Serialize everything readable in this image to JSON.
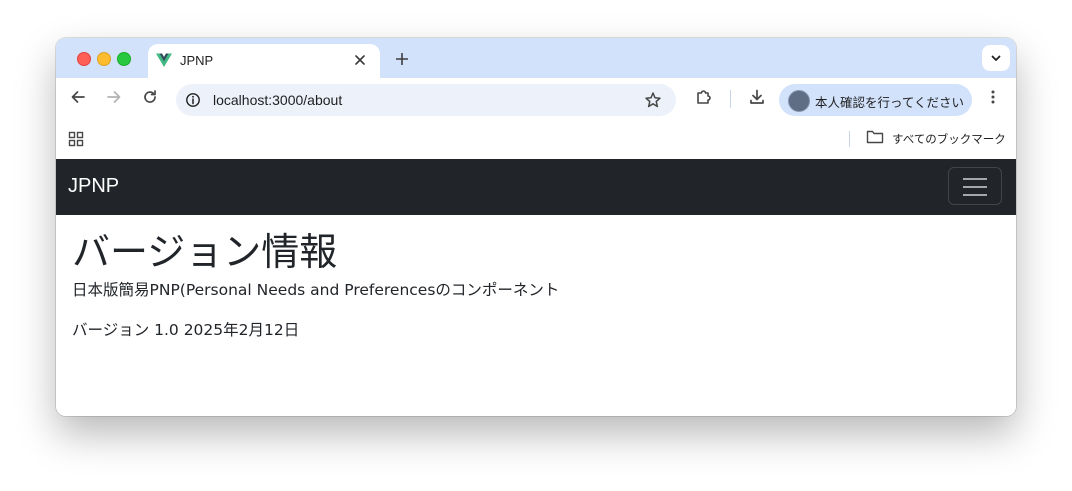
{
  "browser": {
    "tab": {
      "title": "JPNP"
    },
    "address_bar": {
      "url": "localhost:3000/about"
    },
    "profile": {
      "label": "本人確認を行ってください"
    },
    "bookmarks": {
      "all_bookmarks_label": "すべてのブックマーク"
    },
    "icons": {
      "back": "arrow-left-icon",
      "forward": "arrow-right-icon",
      "reload": "reload-icon",
      "info": "info-icon",
      "bookmark_star": "star-icon",
      "extensions": "puzzle-icon",
      "download": "download-icon",
      "menu": "more-vert-icon",
      "apps": "apps-grid-icon",
      "folder": "folder-icon",
      "tab_search": "chevron-down-icon",
      "new_tab": "plus-icon",
      "tab_close": "close-icon"
    }
  },
  "app": {
    "navbar": {
      "brand": "JPNP",
      "bg_color": "#212529"
    },
    "heading": "バージョン情報",
    "description": "日本版簡易PNP(Personal Needs and Preferencesのコンポーネント",
    "version_text": "バージョン 1.0 2025年2月12日"
  }
}
